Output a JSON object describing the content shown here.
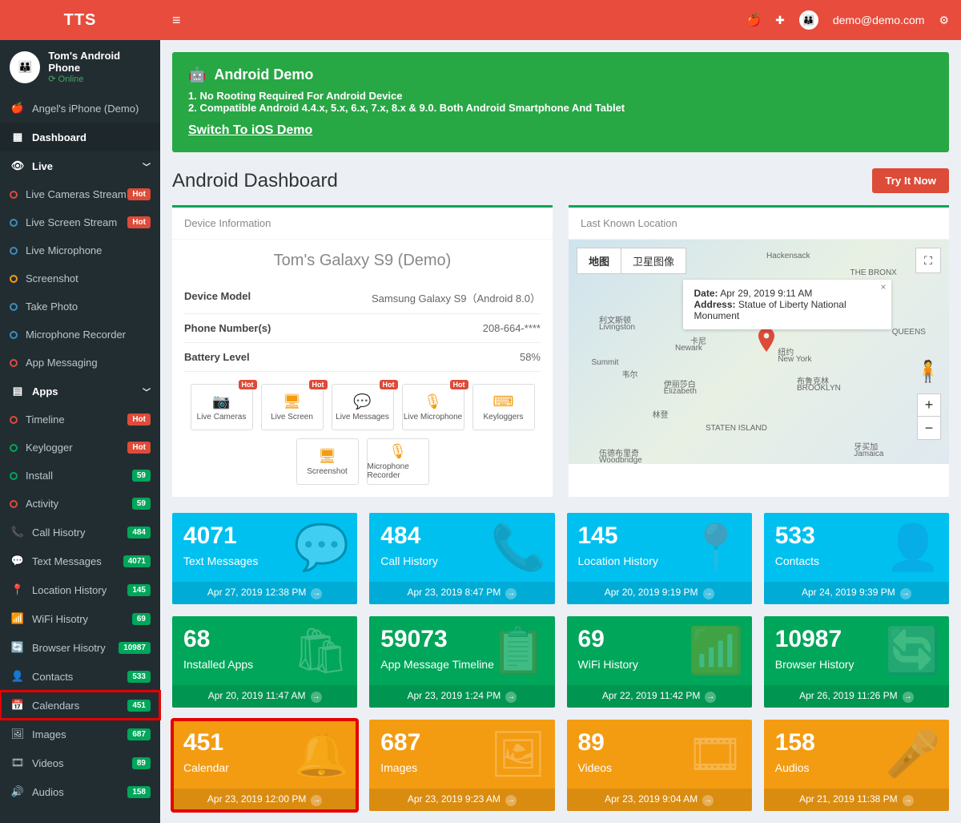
{
  "brand": "TTS",
  "topbar": {
    "user_email": "demo@demo.com"
  },
  "user_panel": {
    "device_name": "Tom's Android Phone",
    "status": "Online"
  },
  "sidebar": {
    "demo_link": "Angel's iPhone (Demo)",
    "dashboard": "Dashboard",
    "live_header": "Live",
    "live_items": [
      {
        "label": "Live Cameras Stream",
        "circ": "red",
        "badge": "Hot",
        "badge_color": "red"
      },
      {
        "label": "Live Screen Stream",
        "circ": "blue",
        "badge": "Hot",
        "badge_color": "red"
      },
      {
        "label": "Live Microphone",
        "circ": "blue",
        "badge": "",
        "badge_color": ""
      },
      {
        "label": "Screenshot",
        "circ": "orange",
        "badge": "",
        "badge_color": ""
      },
      {
        "label": "Take Photo",
        "circ": "blue",
        "badge": "",
        "badge_color": ""
      },
      {
        "label": "Microphone Recorder",
        "circ": "blue",
        "badge": "",
        "badge_color": ""
      },
      {
        "label": "App Messaging",
        "circ": "red",
        "badge": "",
        "badge_color": ""
      }
    ],
    "apps_header": "Apps",
    "apps_items": [
      {
        "label": "Timeline",
        "circ": "red",
        "badge": "Hot",
        "badge_color": "red"
      },
      {
        "label": "Keylogger",
        "circ": "green",
        "badge": "Hot",
        "badge_color": "red"
      },
      {
        "label": "Install",
        "circ": "green",
        "badge": "59",
        "badge_color": "green"
      },
      {
        "label": "Activity",
        "circ": "red",
        "badge": "59",
        "badge_color": "green"
      }
    ],
    "main_items": [
      {
        "icon": "📞",
        "label": "Call Hisotry",
        "badge": "484"
      },
      {
        "icon": "💬",
        "label": "Text Messages",
        "badge": "4071"
      },
      {
        "icon": "📍",
        "label": "Location History",
        "badge": "145"
      },
      {
        "icon": "📶",
        "label": "WiFi Hisotry",
        "badge": "69"
      },
      {
        "icon": "🔄",
        "label": "Browser Hisotry",
        "badge": "10987"
      },
      {
        "icon": "👤",
        "label": "Contacts",
        "badge": "533"
      },
      {
        "icon": "📅",
        "label": "Calendars",
        "badge": "451",
        "highlighted": true
      },
      {
        "icon": "🖼",
        "label": "Images",
        "badge": "687"
      },
      {
        "icon": "🎞",
        "label": "Videos",
        "badge": "89"
      },
      {
        "icon": "🔊",
        "label": "Audios",
        "badge": "158"
      }
    ]
  },
  "alert": {
    "title": "Android Demo",
    "lines": [
      "1. No Rooting Required For Android Device",
      "2. Compatible Android 4.4.x, 5.x, 6.x, 7.x, 8.x & 9.0. Both Android Smartphone And Tablet"
    ],
    "link": "Switch To iOS Demo"
  },
  "page_title": "Android Dashboard",
  "try_button": "Try It Now",
  "device_info": {
    "header": "Device Information",
    "title": "Tom's Galaxy S9 (Demo)",
    "specs": [
      {
        "label": "Device Model",
        "value": "Samsung Galaxy S9（Android 8.0）"
      },
      {
        "label": "Phone Number(s)",
        "value": "208-664-****"
      },
      {
        "label": "Battery Level",
        "value": "58%"
      }
    ],
    "quick_actions": [
      {
        "label": "Live Cameras",
        "hot": true
      },
      {
        "label": "Live Screen",
        "hot": true
      },
      {
        "label": "Live Messages",
        "hot": true
      },
      {
        "label": "Live Microphone",
        "hot": true
      },
      {
        "label": "Keyloggers",
        "hot": false
      },
      {
        "label": "Screenshot",
        "hot": false
      },
      {
        "label": "Microphone Recorder",
        "hot": false
      }
    ]
  },
  "map": {
    "header": "Last Known Location",
    "tab_map": "地图",
    "tab_sat": "卫星图像",
    "tooltip_date_label": "Date:",
    "tooltip_date": "Apr 29, 2019 9:11 AM",
    "tooltip_addr_label": "Address:",
    "tooltip_addr": "Statue of Liberty National Monument",
    "places": [
      "Hackensack",
      "利文斯顿",
      "Livingston",
      "Newark",
      "纽约",
      "New York",
      "伊丽莎白",
      "Elizabeth",
      "林登",
      "伍德布里奇",
      "Woodbridge",
      "THE BRONX",
      "布鲁克林",
      "BROOKLYN",
      "Summit",
      "韦尔",
      "STATEN ISLAND",
      "牙买加",
      "Jamaica",
      "QUEENS",
      "卡尼"
    ]
  },
  "stats": [
    {
      "num": "4071",
      "label": "Text Messages",
      "footer": "Apr 27, 2019 12:38 PM",
      "color": "blue",
      "icon": "💬"
    },
    {
      "num": "484",
      "label": "Call History",
      "footer": "Apr 23, 2019 8:47 PM",
      "color": "blue",
      "icon": "📞"
    },
    {
      "num": "145",
      "label": "Location History",
      "footer": "Apr 20, 2019 9:19 PM",
      "color": "blue",
      "icon": "📍"
    },
    {
      "num": "533",
      "label": "Contacts",
      "footer": "Apr 24, 2019 9:39 PM",
      "color": "blue",
      "icon": "👤"
    },
    {
      "num": "68",
      "label": "Installed Apps",
      "footer": "Apr 20, 2019 11:47 AM",
      "color": "green",
      "icon": "🛍"
    },
    {
      "num": "59073",
      "label": "App Message Timeline",
      "footer": "Apr 23, 2019 1:24 PM",
      "color": "green",
      "icon": "📋"
    },
    {
      "num": "69",
      "label": "WiFi History",
      "footer": "Apr 22, 2019 11:42 PM",
      "color": "green",
      "icon": "📶"
    },
    {
      "num": "10987",
      "label": "Browser History",
      "footer": "Apr 26, 2019 11:26 PM",
      "color": "green",
      "icon": "🔄"
    },
    {
      "num": "451",
      "label": "Calendar",
      "footer": "Apr 23, 2019 12:00 PM",
      "color": "orange",
      "icon": "🔔",
      "highlighted": true
    },
    {
      "num": "687",
      "label": "Images",
      "footer": "Apr 23, 2019 9:23 AM",
      "color": "orange",
      "icon": "🖼"
    },
    {
      "num": "89",
      "label": "Videos",
      "footer": "Apr 23, 2019 9:04 AM",
      "color": "orange",
      "icon": "🎞"
    },
    {
      "num": "158",
      "label": "Audios",
      "footer": "Apr 21, 2019 11:38 PM",
      "color": "orange",
      "icon": "🎤"
    }
  ]
}
